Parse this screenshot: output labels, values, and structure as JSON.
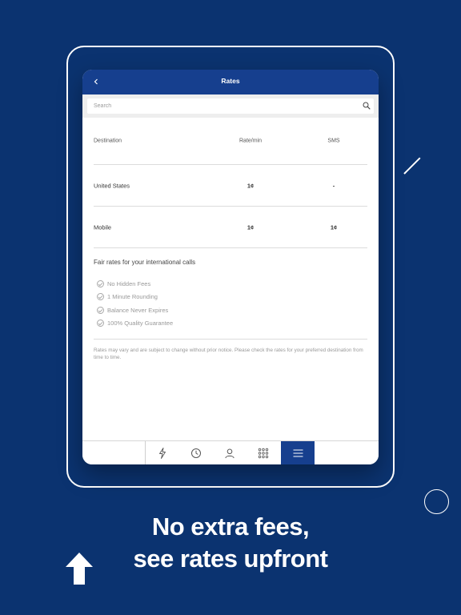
{
  "header": {
    "title": "Rates"
  },
  "search": {
    "placeholder": "Search"
  },
  "table": {
    "columns": [
      "Destination",
      "Rate/min",
      "SMS"
    ],
    "rows": [
      {
        "destination": "United States",
        "rate": "1¢",
        "sms": "-"
      },
      {
        "destination": "Mobile",
        "rate": "1¢",
        "sms": "1¢"
      }
    ]
  },
  "info": {
    "heading": "Fair rates for your international calls",
    "features": [
      "No Hidden Fees",
      "1 Minute Rounding",
      "Balance Never Expires",
      "100% Quality Guarantee"
    ],
    "note": "Rates may vary and are subject to change without prior notice. Please check the rates for your preferred destination from time to time."
  },
  "tabbar": {
    "icons": [
      "lightning-icon",
      "clock-icon",
      "person-icon",
      "grid-icon",
      "menu-icon"
    ],
    "active": "menu-icon"
  },
  "promo": {
    "line1": "No extra fees,",
    "line2": "see rates upfront"
  },
  "colors": {
    "background": "#0b3370",
    "accent": "#163f8e"
  }
}
